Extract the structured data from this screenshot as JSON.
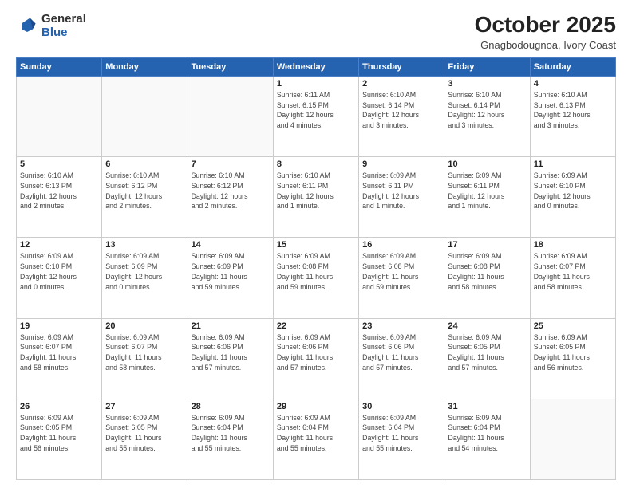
{
  "header": {
    "logo_general": "General",
    "logo_blue": "Blue",
    "title": "October 2025",
    "subtitle": "Gnagbodougnoa, Ivory Coast"
  },
  "weekdays": [
    "Sunday",
    "Monday",
    "Tuesday",
    "Wednesday",
    "Thursday",
    "Friday",
    "Saturday"
  ],
  "weeks": [
    [
      {
        "day": "",
        "info": ""
      },
      {
        "day": "",
        "info": ""
      },
      {
        "day": "",
        "info": ""
      },
      {
        "day": "1",
        "info": "Sunrise: 6:11 AM\nSunset: 6:15 PM\nDaylight: 12 hours\nand 4 minutes."
      },
      {
        "day": "2",
        "info": "Sunrise: 6:10 AM\nSunset: 6:14 PM\nDaylight: 12 hours\nand 3 minutes."
      },
      {
        "day": "3",
        "info": "Sunrise: 6:10 AM\nSunset: 6:14 PM\nDaylight: 12 hours\nand 3 minutes."
      },
      {
        "day": "4",
        "info": "Sunrise: 6:10 AM\nSunset: 6:13 PM\nDaylight: 12 hours\nand 3 minutes."
      }
    ],
    [
      {
        "day": "5",
        "info": "Sunrise: 6:10 AM\nSunset: 6:13 PM\nDaylight: 12 hours\nand 2 minutes."
      },
      {
        "day": "6",
        "info": "Sunrise: 6:10 AM\nSunset: 6:12 PM\nDaylight: 12 hours\nand 2 minutes."
      },
      {
        "day": "7",
        "info": "Sunrise: 6:10 AM\nSunset: 6:12 PM\nDaylight: 12 hours\nand 2 minutes."
      },
      {
        "day": "8",
        "info": "Sunrise: 6:10 AM\nSunset: 6:11 PM\nDaylight: 12 hours\nand 1 minute."
      },
      {
        "day": "9",
        "info": "Sunrise: 6:09 AM\nSunset: 6:11 PM\nDaylight: 12 hours\nand 1 minute."
      },
      {
        "day": "10",
        "info": "Sunrise: 6:09 AM\nSunset: 6:11 PM\nDaylight: 12 hours\nand 1 minute."
      },
      {
        "day": "11",
        "info": "Sunrise: 6:09 AM\nSunset: 6:10 PM\nDaylight: 12 hours\nand 0 minutes."
      }
    ],
    [
      {
        "day": "12",
        "info": "Sunrise: 6:09 AM\nSunset: 6:10 PM\nDaylight: 12 hours\nand 0 minutes."
      },
      {
        "day": "13",
        "info": "Sunrise: 6:09 AM\nSunset: 6:09 PM\nDaylight: 12 hours\nand 0 minutes."
      },
      {
        "day": "14",
        "info": "Sunrise: 6:09 AM\nSunset: 6:09 PM\nDaylight: 11 hours\nand 59 minutes."
      },
      {
        "day": "15",
        "info": "Sunrise: 6:09 AM\nSunset: 6:08 PM\nDaylight: 11 hours\nand 59 minutes."
      },
      {
        "day": "16",
        "info": "Sunrise: 6:09 AM\nSunset: 6:08 PM\nDaylight: 11 hours\nand 59 minutes."
      },
      {
        "day": "17",
        "info": "Sunrise: 6:09 AM\nSunset: 6:08 PM\nDaylight: 11 hours\nand 58 minutes."
      },
      {
        "day": "18",
        "info": "Sunrise: 6:09 AM\nSunset: 6:07 PM\nDaylight: 11 hours\nand 58 minutes."
      }
    ],
    [
      {
        "day": "19",
        "info": "Sunrise: 6:09 AM\nSunset: 6:07 PM\nDaylight: 11 hours\nand 58 minutes."
      },
      {
        "day": "20",
        "info": "Sunrise: 6:09 AM\nSunset: 6:07 PM\nDaylight: 11 hours\nand 58 minutes."
      },
      {
        "day": "21",
        "info": "Sunrise: 6:09 AM\nSunset: 6:06 PM\nDaylight: 11 hours\nand 57 minutes."
      },
      {
        "day": "22",
        "info": "Sunrise: 6:09 AM\nSunset: 6:06 PM\nDaylight: 11 hours\nand 57 minutes."
      },
      {
        "day": "23",
        "info": "Sunrise: 6:09 AM\nSunset: 6:06 PM\nDaylight: 11 hours\nand 57 minutes."
      },
      {
        "day": "24",
        "info": "Sunrise: 6:09 AM\nSunset: 6:05 PM\nDaylight: 11 hours\nand 57 minutes."
      },
      {
        "day": "25",
        "info": "Sunrise: 6:09 AM\nSunset: 6:05 PM\nDaylight: 11 hours\nand 56 minutes."
      }
    ],
    [
      {
        "day": "26",
        "info": "Sunrise: 6:09 AM\nSunset: 6:05 PM\nDaylight: 11 hours\nand 56 minutes."
      },
      {
        "day": "27",
        "info": "Sunrise: 6:09 AM\nSunset: 6:05 PM\nDaylight: 11 hours\nand 55 minutes."
      },
      {
        "day": "28",
        "info": "Sunrise: 6:09 AM\nSunset: 6:04 PM\nDaylight: 11 hours\nand 55 minutes."
      },
      {
        "day": "29",
        "info": "Sunrise: 6:09 AM\nSunset: 6:04 PM\nDaylight: 11 hours\nand 55 minutes."
      },
      {
        "day": "30",
        "info": "Sunrise: 6:09 AM\nSunset: 6:04 PM\nDaylight: 11 hours\nand 55 minutes."
      },
      {
        "day": "31",
        "info": "Sunrise: 6:09 AM\nSunset: 6:04 PM\nDaylight: 11 hours\nand 54 minutes."
      },
      {
        "day": "",
        "info": ""
      }
    ]
  ]
}
